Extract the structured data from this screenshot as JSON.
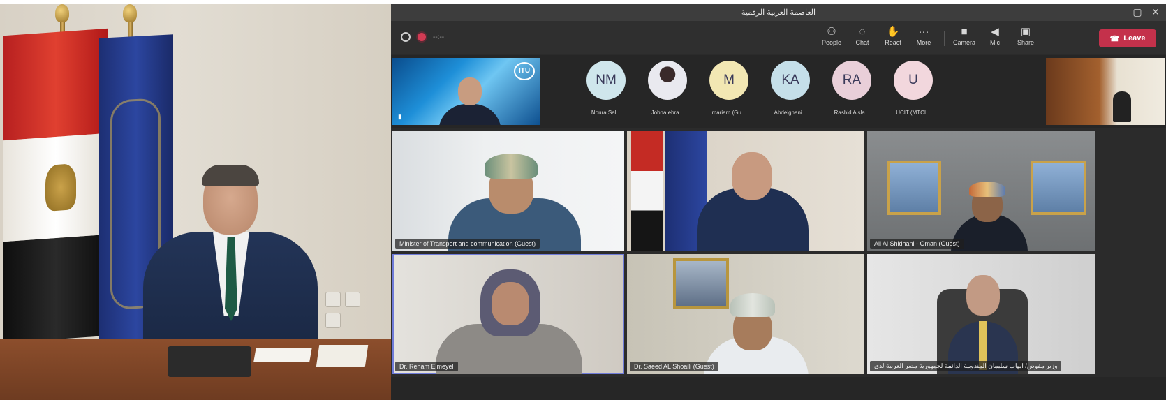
{
  "window": {
    "title": "العاصمة العربية الرقمية"
  },
  "toolbar": {
    "timer": "--:--",
    "buttons": [
      {
        "label": "People",
        "icon": "people-icon"
      },
      {
        "label": "Chat",
        "icon": "chat-icon"
      },
      {
        "label": "React",
        "icon": "react-icon"
      },
      {
        "label": "More",
        "icon": "more-icon"
      },
      {
        "label": "Camera",
        "icon": "camera-icon"
      },
      {
        "label": "Mic",
        "icon": "mic-icon"
      },
      {
        "label": "Share",
        "icon": "share-icon"
      }
    ],
    "leave_label": "Leave",
    "leave_color": "#c4314b"
  },
  "strip": {
    "logo_text": "ITU",
    "participants": [
      {
        "initials": "NM",
        "name": "Noura Sal...",
        "color": "#cfe6ec"
      },
      {
        "initials": "",
        "name": "Jobna ebra...",
        "color": "#e9e9ef"
      },
      {
        "initials": "M",
        "name": "mariam (Gu...",
        "color": "#f2e7b3"
      },
      {
        "initials": "KA",
        "name": "Abdelghani...",
        "color": "#c5dfe9"
      },
      {
        "initials": "RA",
        "name": "Rashid Alsla...",
        "color": "#e9cfd9"
      },
      {
        "initials": "U",
        "name": "UCIT (MTCI...",
        "color": "#f2d7dd"
      }
    ]
  },
  "tiles": [
    {
      "name": "Minister of Transport and communication (Guest)"
    },
    {
      "name": ""
    },
    {
      "name": "Ali Al Shidhani - Oman (Guest)"
    },
    {
      "name": "Dr. Reham Elmeyel"
    },
    {
      "name": "Dr. Saeed AL Shoaili (Guest)"
    },
    {
      "name": "وزير مفوض/ ايهاب سليمان المندوبية الدائمة لجمهورية مصر العربية لدى"
    }
  ]
}
